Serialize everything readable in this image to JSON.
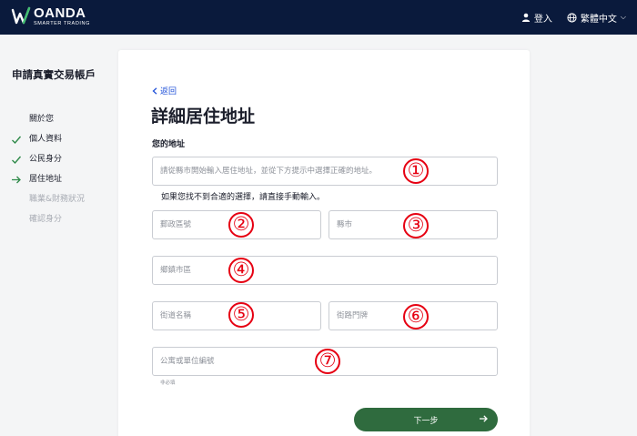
{
  "header": {
    "brand": "OANDA",
    "tagline": "SMARTER TRADING",
    "login_label": "登入",
    "language_label": "繁體中文"
  },
  "sidebar": {
    "title": "申請真實交易帳戶",
    "steps": [
      {
        "label": "關於您",
        "state": "header"
      },
      {
        "label": "個人資料",
        "state": "done"
      },
      {
        "label": "公民身分",
        "state": "done"
      },
      {
        "label": "居住地址",
        "state": "current"
      },
      {
        "label": "職業&財務狀況",
        "state": "pending"
      },
      {
        "label": "確認身分",
        "state": "pending"
      }
    ]
  },
  "form": {
    "back_label": "返回",
    "title": "詳細居住地址",
    "section_label": "您的地址",
    "address_search_placeholder": "請從縣市開始輸入居住地址，並從下方提示中選擇正確的地址。",
    "manual_hint": "如果您找不到合適的選擇，請直接手動輸入。",
    "postal_code_placeholder": "郵政區號",
    "city_placeholder": "縣市",
    "district_placeholder": "鄉鎮市區",
    "street_placeholder": "街道名稱",
    "street_number_placeholder": "街路門牌",
    "unit_placeholder": "公寓或單位編號",
    "optional_label": "非必填",
    "next_label": "下一步"
  },
  "annotations": [
    "①",
    "②",
    "③",
    "④",
    "⑤",
    "⑥",
    "⑦"
  ],
  "colors": {
    "header_bg": "#0a1a3c",
    "accent_green": "#2f6b3e",
    "link_blue": "#1d4fd8",
    "annotation_red": "#e60012"
  }
}
